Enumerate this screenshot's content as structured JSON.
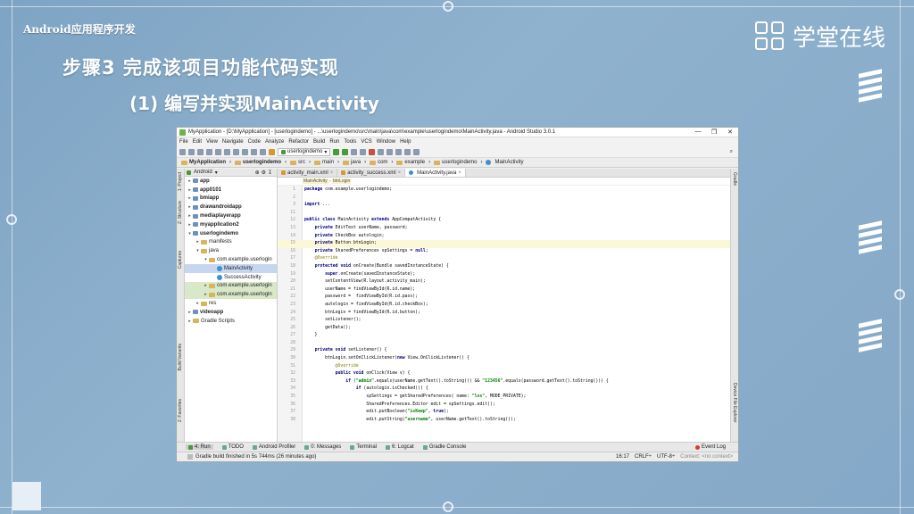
{
  "slide": {
    "brand": "Android应用程序开发",
    "logo_text": "学堂在线",
    "heading": "步骤3 完成该项目功能代码实现",
    "subheading": "(1) 编写并实现MainActivity"
  },
  "ide": {
    "title": "MyApplication - [D:\\MyApplication] - [userlogindemo] - ...\\userlogindemo\\src\\main\\java\\com\\example\\userlogindemo\\MainActivity.java - Android Studio 3.0.1",
    "menu": [
      "File",
      "Edit",
      "View",
      "Navigate",
      "Code",
      "Analyze",
      "Refactor",
      "Build",
      "Run",
      "Tools",
      "VCS",
      "Window",
      "Help"
    ],
    "run_config": "userlogindemo",
    "breadcrumbs": [
      "MyApplication",
      "userlogindemo",
      "src",
      "main",
      "java",
      "com",
      "example",
      "userlogindemo",
      "MainActivity"
    ],
    "project_view": "Android",
    "tree": [
      {
        "label": "app",
        "indent": 0,
        "arrow": "▸",
        "type": "mod"
      },
      {
        "label": "app0101",
        "indent": 0,
        "arrow": "▸",
        "type": "mod"
      },
      {
        "label": "bmiapp",
        "indent": 0,
        "arrow": "▸",
        "type": "mod"
      },
      {
        "label": "drawandroidapp",
        "indent": 0,
        "arrow": "▸",
        "type": "mod"
      },
      {
        "label": "mediaplayerapp",
        "indent": 0,
        "arrow": "▸",
        "type": "mod"
      },
      {
        "label": "myapplication2",
        "indent": 0,
        "arrow": "▸",
        "type": "mod"
      },
      {
        "label": "userlogindemo",
        "indent": 0,
        "arrow": "▾",
        "type": "mod"
      },
      {
        "label": "manifests",
        "indent": 1,
        "arrow": "▸",
        "type": "folder"
      },
      {
        "label": "java",
        "indent": 1,
        "arrow": "▾",
        "type": "folder"
      },
      {
        "label": "com.example.userlogin",
        "indent": 2,
        "arrow": "▾",
        "type": "folder"
      },
      {
        "label": "MainActivity",
        "indent": 3,
        "arrow": "",
        "type": "cls",
        "state": "sel"
      },
      {
        "label": "SuccessActivity",
        "indent": 3,
        "arrow": "",
        "type": "cls"
      },
      {
        "label": "com.example.userlogin",
        "indent": 2,
        "arrow": "▸",
        "type": "folder",
        "state": "hl"
      },
      {
        "label": "com.example.userlogin",
        "indent": 2,
        "arrow": "▸",
        "type": "folder",
        "state": "hl"
      },
      {
        "label": "res",
        "indent": 1,
        "arrow": "▸",
        "type": "folder"
      },
      {
        "label": "videoapp",
        "indent": 0,
        "arrow": "▸",
        "type": "mod"
      },
      {
        "label": "Gradle Scripts",
        "indent": 0,
        "arrow": "▸",
        "type": "folder"
      }
    ],
    "tabs": [
      {
        "label": "activity_main.xml",
        "active": false
      },
      {
        "label": "activity_success.xml",
        "active": false
      },
      {
        "label": "MainActivity.java",
        "active": true
      }
    ],
    "code_crumb": [
      "MainActivity",
      "btnLogin"
    ],
    "code": [
      {
        "n": "1",
        "t": "package com.example.userlogindemo;"
      },
      {
        "n": "2",
        "t": ""
      },
      {
        "n": "3",
        "t": "import ..."
      },
      {
        "n": "11",
        "t": ""
      },
      {
        "n": "12",
        "t": "public class MainActivity extends AppCompatActivity {"
      },
      {
        "n": "13",
        "t": "    private EditText userName, password;"
      },
      {
        "n": "14",
        "t": "    private CheckBox autologin;"
      },
      {
        "n": "15",
        "t": "    private Button btnLogin;",
        "caret": true
      },
      {
        "n": "16",
        "t": "    private SharedPreferences spSettings = null;"
      },
      {
        "n": "17",
        "t": "    @Override"
      },
      {
        "n": "18",
        "t": "    protected void onCreate(Bundle savedInstanceState) {"
      },
      {
        "n": "19",
        "t": "        super.onCreate(savedInstanceState);"
      },
      {
        "n": "20",
        "t": "        setContentView(R.layout.activity_main);"
      },
      {
        "n": "21",
        "t": "        userName = findViewById(R.id.name);"
      },
      {
        "n": "22",
        "t": "        password =  findViewById(R.id.pass);"
      },
      {
        "n": "23",
        "t": "        autologin = findViewById(R.id.checkBox);"
      },
      {
        "n": "24",
        "t": "        btnLogin = findViewById(R.id.button);"
      },
      {
        "n": "25",
        "t": "        setListener();"
      },
      {
        "n": "26",
        "t": "        getData();"
      },
      {
        "n": "27",
        "t": "    }"
      },
      {
        "n": "28",
        "t": ""
      },
      {
        "n": "29",
        "t": "    private void setListener() {"
      },
      {
        "n": "30",
        "t": "        btnLogin.setOnClickListener(new View.OnClickListener() {"
      },
      {
        "n": "31",
        "t": "            @Override"
      },
      {
        "n": "32",
        "t": "            public void onClick(View v) {"
      },
      {
        "n": "33",
        "t": "                if (\"admin\".equals(userName.getText().toString()) && \"123456\".equals(password.getText().toString())) {"
      },
      {
        "n": "34",
        "t": "                    if (autologin.isChecked()) {"
      },
      {
        "n": "35",
        "t": "                        spSettings = getSharedPreferences( name: \"lss\", MODE_PRIVATE);"
      },
      {
        "n": "36",
        "t": "                        SharedPreferences.Editor edit = spSettings.edit();"
      },
      {
        "n": "37",
        "t": "                        edit.putBoolean(\"isKeep\", true);"
      },
      {
        "n": "38",
        "t": "                        edit.putString(\"username\", userName.getText().toString());"
      }
    ],
    "left_strip": [
      "1: Project",
      "Z: Structure",
      "Captures",
      "Build Variants",
      "2: Favorites"
    ],
    "right_strip": [
      "Gradle",
      "Device File Explorer"
    ],
    "bottom_tabs": [
      "4: Run",
      "TODO",
      "Android Profiler",
      "0: Messages",
      "Terminal",
      "6: Logcat",
      "Gradle Console"
    ],
    "event_log": "Event Log",
    "status": "Gradle build finished in 5s 744ms (26 minutes ago)",
    "status_right": [
      "16:17",
      "CRLF÷",
      "UTF-8÷",
      "Context: <no context>"
    ]
  }
}
